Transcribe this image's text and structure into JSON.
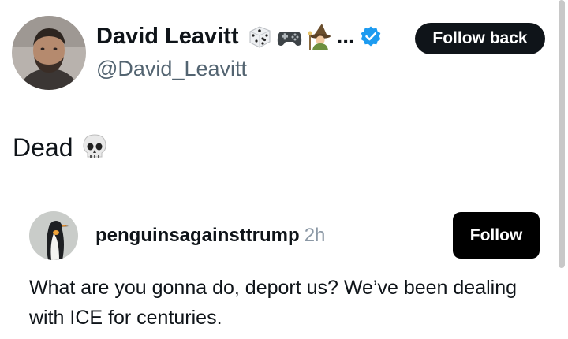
{
  "profile": {
    "display_name": "David Leavitt",
    "name_overflow": "...",
    "handle": "@David_Leavitt",
    "follow_back_label": "Follow back",
    "emojis": [
      "die-icon",
      "game-controller-icon",
      "mage-icon"
    ],
    "verified_color": "#1d9bf0"
  },
  "post": {
    "text": "Dead",
    "emoji": "skull-icon"
  },
  "quoted_post": {
    "username": "penguinsagainsttrump",
    "time": "2h",
    "follow_label": "Follow",
    "text": "What are you gonna do, deport us? We’ve been dealing with ICE for centuries."
  },
  "colors": {
    "text": "#0f1419",
    "secondary_text": "#536471",
    "button_bg": "#0f1419"
  }
}
